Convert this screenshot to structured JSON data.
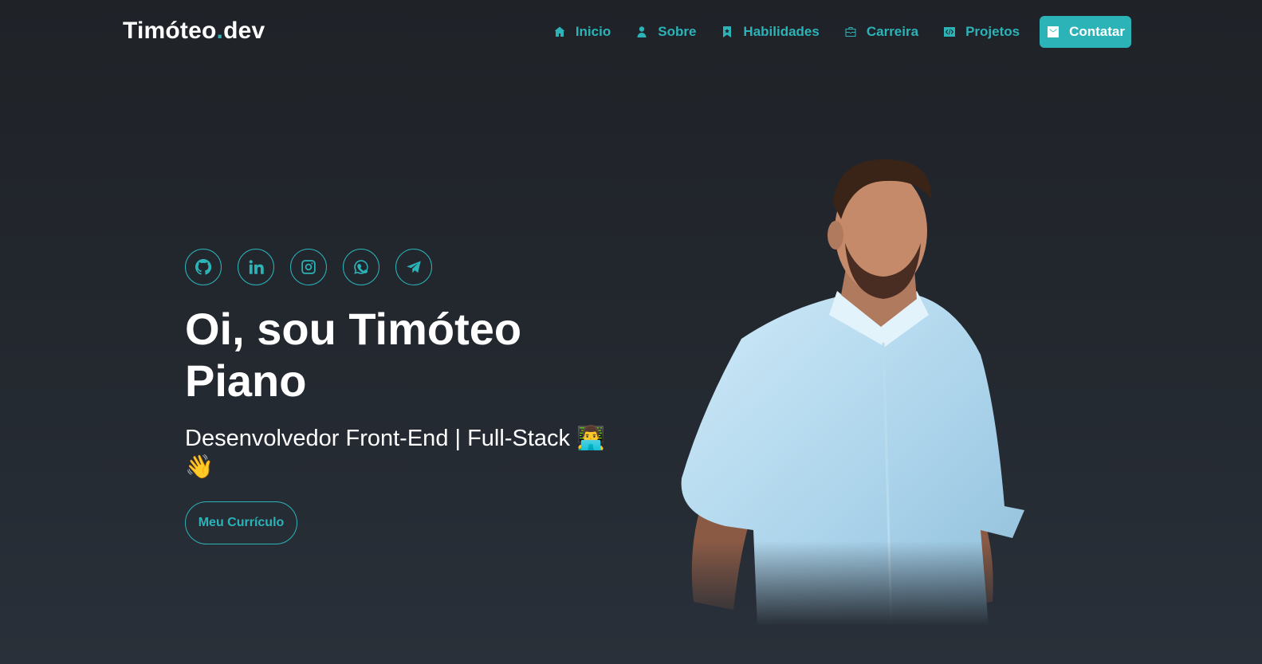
{
  "header": {
    "logo_main": "Timóteo",
    "logo_dot": ".",
    "logo_suffix": "dev",
    "nav": [
      {
        "label": "Inicio",
        "icon": "home-icon"
      },
      {
        "label": "Sobre",
        "icon": "user-icon"
      },
      {
        "label": "Habilidades",
        "icon": "bookmark-icon"
      },
      {
        "label": "Carreira",
        "icon": "briefcase-icon"
      },
      {
        "label": "Projetos",
        "icon": "code-icon"
      }
    ],
    "cta": {
      "label": "Contatar",
      "icon": "mail-icon"
    }
  },
  "socials": [
    "github-icon",
    "linkedin-icon",
    "instagram-icon",
    "whatsapp-icon",
    "telegram-icon"
  ],
  "hero": {
    "title": "Oi, sou Timóteo Piano",
    "subtitle": "Desenvolvedor Front-End | Full-Stack 👨‍💻👋",
    "cv_button": "Meu Currículo"
  },
  "colors": {
    "accent": "#2bb3b8",
    "background_top": "#1f2227",
    "background_bottom": "#293039",
    "text": "#ffffff"
  }
}
